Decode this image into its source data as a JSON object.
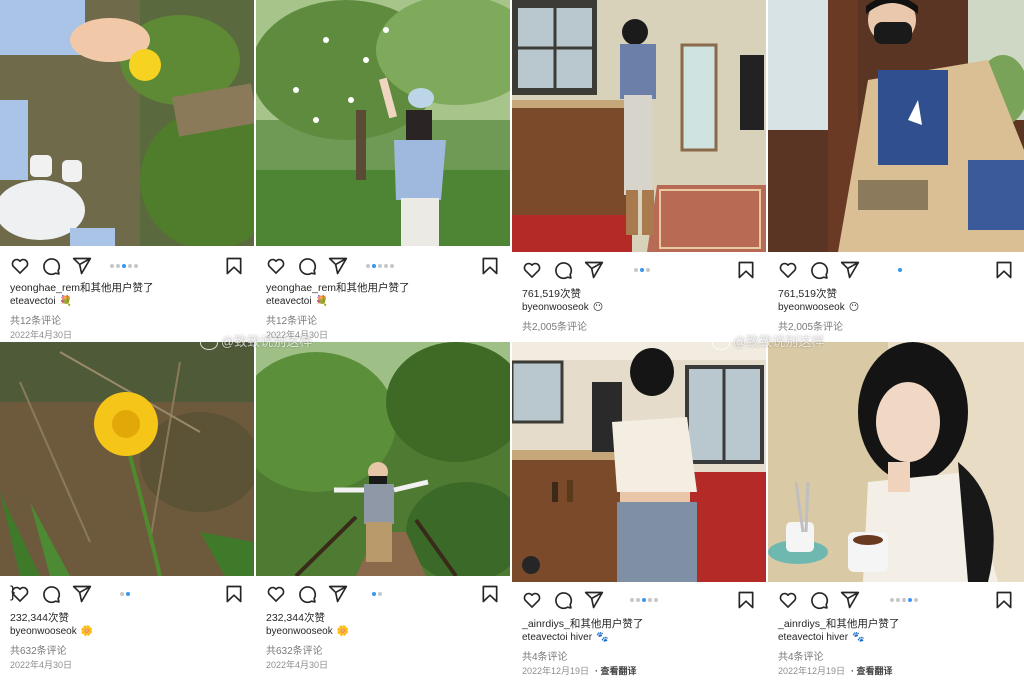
{
  "posts": [
    {
      "likes": "yeonghae_rem和其他用户赞了",
      "author": "eteavectoi",
      "emoji": "💐",
      "comments": "共12条评论",
      "date": "2022年4月30日",
      "dots": 5,
      "active": 2
    },
    {
      "likes": "yeonghae_rem和其他用户赞了",
      "author": "eteavectoi",
      "emoji": "💐",
      "comments": "共12条评论",
      "date": "2022年4月30日",
      "dots": 5,
      "active": 1
    },
    {
      "likes": "761,519次赞",
      "author": "byeonwooseok",
      "emoji": "😶",
      "comments": "共2,005条评论",
      "date": "",
      "dots": 3,
      "active": 1
    },
    {
      "likes": "761,519次赞",
      "author": "byeonwooseok",
      "emoji": "😶",
      "comments": "共2,005条评论",
      "date": "",
      "dots": 1,
      "active": 0
    },
    {
      "likes": "232,344次赞",
      "author": "byeonwooseok",
      "emoji": "🌼",
      "comments": "共632条评论",
      "date": "2022年4月30日",
      "dots": 2,
      "active": 1
    },
    {
      "likes": "232,344次赞",
      "author": "byeonwooseok",
      "emoji": "🌼",
      "comments": "共632条评论",
      "date": "2022年4月30日",
      "dots": 2,
      "active": 0
    },
    {
      "likes": "_ainrdiys_和其他用户赞了",
      "author": "eteavectoi hiver",
      "emoji": "🐾",
      "comments": "共4条评论",
      "date": "2022年12月19日",
      "translate": "· 查看翻译",
      "dots": 5,
      "active": 2
    },
    {
      "likes": "_ainrdiys_和其他用户赞了",
      "author": "eteavectoi hiver",
      "emoji": "🐾",
      "comments": "共4条评论",
      "date": "2022年12月19日",
      "translate": "· 查看翻译",
      "dots": 5,
      "active": 3
    }
  ],
  "watermarks": [
    "@致致说别这样",
    "@致致说别这样"
  ],
  "icons": [
    "heart-icon",
    "comment-icon",
    "share-icon",
    "bookmark-icon",
    "avatar-icon"
  ],
  "colors": {
    "accent_dot": "#3897f0",
    "idle_dot": "#c7c7c7",
    "text": "#262626",
    "muted": "#8e8e8e"
  }
}
